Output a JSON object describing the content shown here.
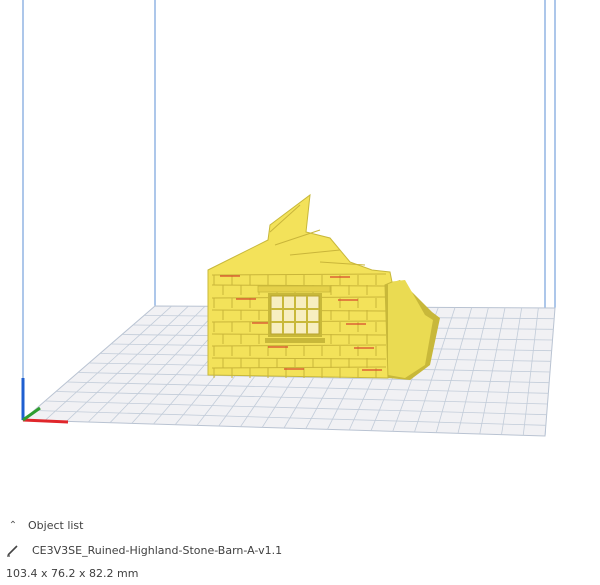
{
  "object_panel": {
    "toggle_label": "Object list",
    "object_name": "CE3V3SE_Ruined-Highland-Stone-Barn-A-v1.1",
    "dimensions": "103.4 x 76.2 x 82.2 mm"
  },
  "colors": {
    "build_volume_line": "#5b8fd6",
    "plate_fill": "#f1f1f4",
    "plate_grid": "#b9c3d2",
    "model_yellow": "#f3e25a",
    "model_shadow": "#c8b83a",
    "axis_x": "#e0262b",
    "axis_y": "#2f9e2f",
    "axis_z": "#1f5fd0"
  },
  "icons": {
    "toggle": "chevron-up-icon",
    "edit": "pencil-icon"
  }
}
